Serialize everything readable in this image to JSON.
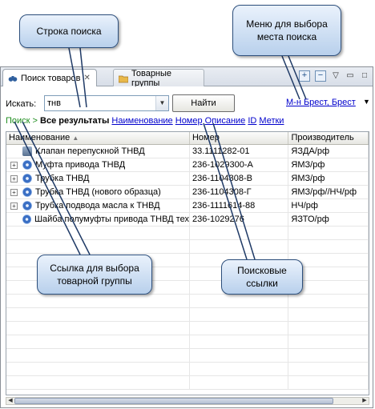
{
  "window": {
    "tabs": [
      {
        "label": "Поиск товаров",
        "active": true
      },
      {
        "label": "Товарные группы",
        "active": false
      }
    ],
    "view_buttons": [
      "plus-icon",
      "minus-icon",
      "menu-arrow-icon",
      "minimize-icon",
      "maximize-icon"
    ]
  },
  "search": {
    "label": "Искать:",
    "query": "тнв",
    "find_label": "Найти",
    "place_label": "М-н Брест, Брест"
  },
  "links": {
    "root": "Поиск",
    "sep": ">",
    "all": "Все результаты",
    "items": [
      "Наименование",
      "Номер",
      "Описание",
      "ID",
      "Метки"
    ]
  },
  "table": {
    "columns": [
      "Наименование",
      "Номер",
      "Производитель"
    ],
    "rows": [
      {
        "expand": false,
        "icon": "lock-icon",
        "name": "Клапан перепускной ТНВД",
        "number": "33.1111282-01",
        "maker": "ЯЗДА/рф"
      },
      {
        "expand": true,
        "icon": "gear-icon",
        "name": "Муфта привода ТНВД",
        "number": "236-1029300-А",
        "maker": "ЯМЗ/рф"
      },
      {
        "expand": true,
        "icon": "gear-icon",
        "name": "Трубка ТНВД",
        "number": "236-1104308-В",
        "maker": "ЯМЗ/рф"
      },
      {
        "expand": true,
        "icon": "gear-icon",
        "name": "Трубка ТНВД (нового образца)",
        "number": "236-1104308-Г",
        "maker": "ЯМЗ/рф//НЧ/рф"
      },
      {
        "expand": true,
        "icon": "gear-icon",
        "name": "Трубка подвода масла к ТНВД",
        "number": "236-1111614-88",
        "maker": "НЧ/рф"
      },
      {
        "expand": false,
        "icon": "gear-icon",
        "name": "Шайба полумуфты привода ТНВД тех",
        "number": "236-1029276",
        "maker": "ЯЗТО/рф"
      }
    ]
  },
  "callouts": {
    "search_line": "Строка поиска",
    "place_menu": "Меню для выбора места поиска",
    "group_link": "Ссылка для выбора товарной группы",
    "search_links": "Поисковые ссылки"
  }
}
